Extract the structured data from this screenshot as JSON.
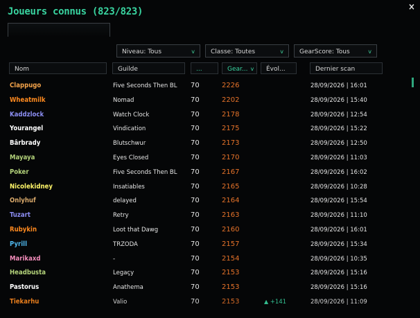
{
  "window": {
    "title": "Joueurs connus (823/823)",
    "close_label": "×"
  },
  "search": {
    "value": ""
  },
  "filters": [
    {
      "label": "Niveau: Tous",
      "chevron": "v"
    },
    {
      "label": "Classe: Toutes",
      "chevron": "v"
    },
    {
      "label": "GearScore: Tous",
      "chevron": "v"
    }
  ],
  "columns": [
    {
      "label": "Nom"
    },
    {
      "label": "Guilde"
    },
    {
      "label": "..."
    },
    {
      "label": "Gear...",
      "sort_arrow": "v"
    },
    {
      "label": "Évol..."
    },
    {
      "label": "Dernier scan"
    }
  ],
  "colors": {
    "accent": "#39d4a0",
    "gearscore": "#e8742a"
  },
  "rows": [
    {
      "name": "Clappugo",
      "name_color": "#f2a24a",
      "guild": "Five Seconds Then BL",
      "level": "70",
      "gearscore": "2226",
      "evolution": "",
      "last_scan": "28/09/2026 | 16:01"
    },
    {
      "name": "Wheatmilk",
      "name_color": "#ff8a1f",
      "guild": "Nomad",
      "level": "70",
      "gearscore": "2202",
      "evolution": "",
      "last_scan": "28/09/2026 | 15:40"
    },
    {
      "name": "Kaddzlock",
      "name_color": "#8a8cf0",
      "guild": "Watch Clock",
      "level": "70",
      "gearscore": "2178",
      "evolution": "",
      "last_scan": "28/09/2026 | 12:54"
    },
    {
      "name": "Yourangel",
      "name_color": "#ffffff",
      "guild": "Vindication",
      "level": "70",
      "gearscore": "2175",
      "evolution": "",
      "last_scan": "28/09/2026 | 15:22"
    },
    {
      "name": "Bârbrady",
      "name_color": "#ffffff",
      "guild": "Blutschwur",
      "level": "70",
      "gearscore": "2173",
      "evolution": "",
      "last_scan": "28/09/2026 | 12:50"
    },
    {
      "name": "Mayaya",
      "name_color": "#b3d27a",
      "guild": "Eyes Closed",
      "level": "70",
      "gearscore": "2170",
      "evolution": "",
      "last_scan": "28/09/2026 | 11:03"
    },
    {
      "name": "Poker",
      "name_color": "#b3d27a",
      "guild": "Five Seconds Then BL",
      "level": "70",
      "gearscore": "2167",
      "evolution": "",
      "last_scan": "28/09/2026 | 16:02"
    },
    {
      "name": "Nicolekidney",
      "name_color": "#fff569",
      "guild": "Insatiables",
      "level": "70",
      "gearscore": "2165",
      "evolution": "",
      "last_scan": "28/09/2026 | 10:28"
    },
    {
      "name": "Onlyhuf",
      "name_color": "#d9a96b",
      "guild": "delayed",
      "level": "70",
      "gearscore": "2164",
      "evolution": "",
      "last_scan": "28/09/2026 | 15:54"
    },
    {
      "name": "Tuzart",
      "name_color": "#8a8cf0",
      "guild": "Retry",
      "level": "70",
      "gearscore": "2163",
      "evolution": "",
      "last_scan": "28/09/2026 | 11:10"
    },
    {
      "name": "Rubykin",
      "name_color": "#ff8a1f",
      "guild": "Loot that Dawg",
      "level": "70",
      "gearscore": "2160",
      "evolution": "",
      "last_scan": "28/09/2026 | 16:01"
    },
    {
      "name": "Pyrill",
      "name_color": "#4fb8ee",
      "guild": "TRZODA",
      "level": "70",
      "gearscore": "2157",
      "evolution": "",
      "last_scan": "28/09/2026 | 15:34"
    },
    {
      "name": "Marikaxd",
      "name_color": "#f28cba",
      "guild": "-",
      "level": "70",
      "gearscore": "2154",
      "evolution": "",
      "last_scan": "28/09/2026 | 10:35"
    },
    {
      "name": "Headbusta",
      "name_color": "#b3d27a",
      "guild": "Legaçy",
      "level": "70",
      "gearscore": "2153",
      "evolution": "",
      "last_scan": "28/09/2026 | 15:16"
    },
    {
      "name": "Pastorus",
      "name_color": "#ffffff",
      "guild": "Anathema",
      "level": "70",
      "gearscore": "2153",
      "evolution": "",
      "last_scan": "28/09/2026 | 15:16"
    },
    {
      "name": "Tiekarhu",
      "name_color": "#ff8a1f",
      "guild": "Valio",
      "level": "70",
      "gearscore": "2153",
      "evolution": "+141",
      "last_scan": "28/09/2026 | 11:09"
    }
  ]
}
